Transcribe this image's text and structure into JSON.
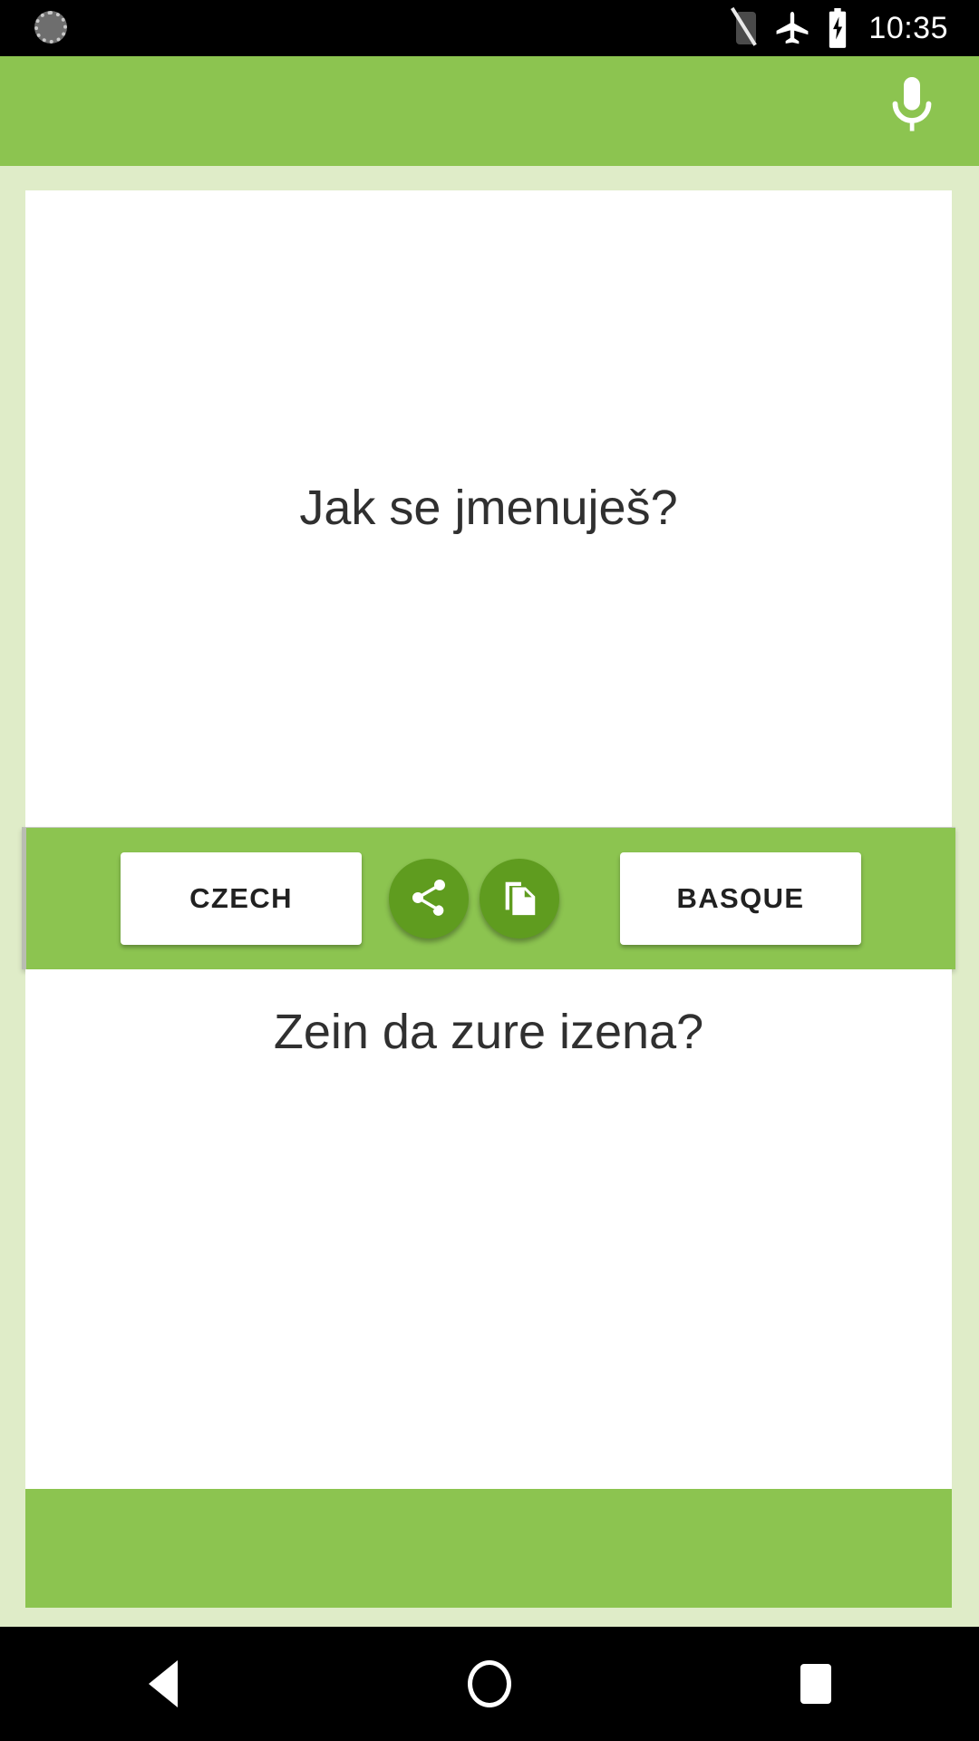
{
  "theme": {
    "accent_green": "#8cc450",
    "fab_green": "#5f9c1f",
    "page_background": "#dfecc8",
    "panel_background": "#ffffff",
    "text_color": "#303030",
    "status_bar_background": "#000000"
  },
  "status_bar": {
    "time": "10:35",
    "icons": [
      "alarm-clock-icon",
      "signal-off-icon",
      "airplane-mode-icon",
      "battery-charging-icon"
    ]
  },
  "app_bar": {
    "mic_icon": "microphone-icon",
    "mic_label": ""
  },
  "source": {
    "language": "CZECH",
    "text": "Jak se jmenuješ?"
  },
  "target": {
    "language": "BASQUE",
    "text": "Zein da zure izena?"
  },
  "actions": {
    "share": {
      "icon": "share-icon",
      "label": ""
    },
    "copy": {
      "icon": "copy-icon",
      "label": ""
    }
  },
  "navigation_bar": {
    "back": "back-triangle-icon",
    "home": "home-circle-icon",
    "recents": "recents-square-icon"
  }
}
